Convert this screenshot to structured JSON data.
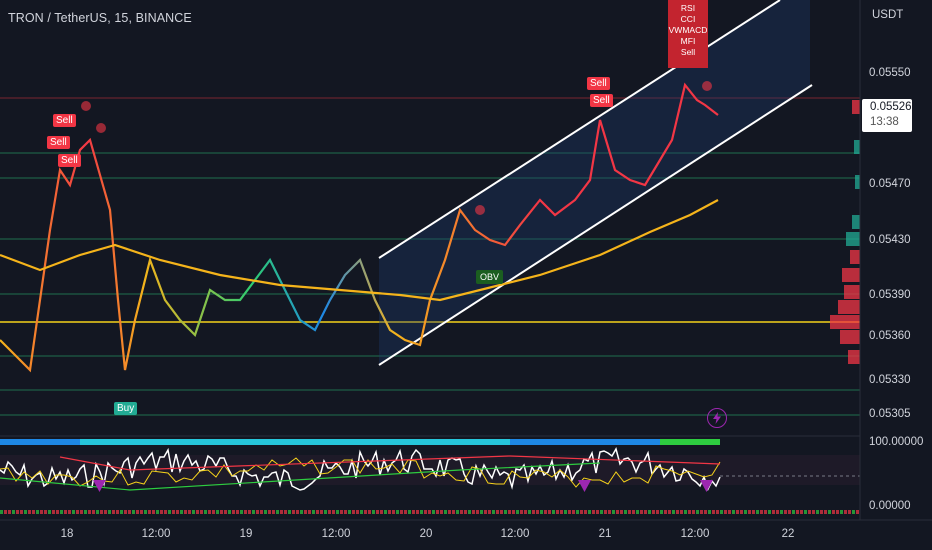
{
  "header": {
    "symbol": "TRON / TetherUS, 15, BINANCE"
  },
  "price_scale": {
    "currency": "USDT",
    "ticks": [
      "0.05550",
      "0.05470",
      "0.05430",
      "0.05390",
      "0.05360",
      "0.05330",
      "0.05305"
    ],
    "last_price": "0.05526",
    "countdown": "13:38"
  },
  "oscillator_scale": {
    "ticks": [
      "100.00000",
      "0.00000"
    ]
  },
  "time_axis": {
    "labels": [
      "18",
      "12:00",
      "19",
      "12:00",
      "20",
      "12:00",
      "21",
      "12:00",
      "22"
    ]
  },
  "signals": {
    "sell_label": "Sell",
    "buy_label": "Buy",
    "obv_label": "OBV",
    "indicator_stack": [
      "RSI",
      "CCI",
      "VWMACD",
      "MFI",
      "Sell"
    ]
  },
  "colors": {
    "background": "#131722",
    "ma_line": "#f5b41b",
    "channel": "#ffffff",
    "sell": "#f23645",
    "buy": "#22ab94",
    "support_line": "#1f6f4f",
    "resistance_line": "#7a2430"
  },
  "icons": {
    "alert": "lightning-icon"
  }
}
